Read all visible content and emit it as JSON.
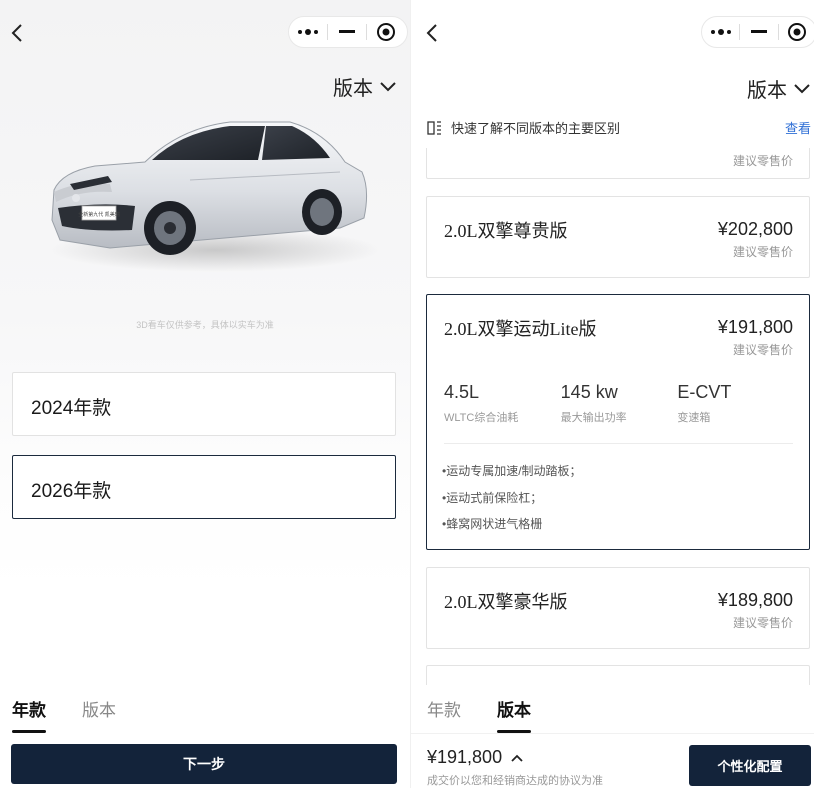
{
  "left": {
    "version_label": "版本",
    "car_disclaimer": "3D看车仅供参考，具体以实车为准",
    "car_plate_text": "全新第九代 凯美瑞",
    "years": [
      {
        "label": "2024年款",
        "selected": false
      },
      {
        "label": "2026年款",
        "selected": true
      }
    ],
    "tabs": [
      {
        "label": "年款",
        "active": true
      },
      {
        "label": "版本",
        "active": false
      }
    ],
    "next_button": "下一步"
  },
  "right": {
    "version_label": "版本",
    "hint_text": "快速了解不同版本的主要区别",
    "hint_link": "查看",
    "partial_top_sub": "建议零售价",
    "versions": [
      {
        "name": "2.0L双擎尊贵版",
        "price": "¥202,800",
        "price_note": "建议零售价",
        "selected": false
      },
      {
        "name": "2.0L双擎运动Lite版",
        "price": "¥191,800",
        "price_note": "建议零售价",
        "selected": true,
        "specs": [
          {
            "value": "4.5L",
            "label": "WLTC综合油耗"
          },
          {
            "value": "145 kw",
            "label": "最大输出功率"
          },
          {
            "value": "E-CVT",
            "label": "变速箱"
          }
        ],
        "features": [
          "•运动专属加速/制动踏板；",
          "•运动式前保险杠；",
          "•蜂窝网状进气格栅"
        ]
      },
      {
        "name": "2.0L双擎豪华版",
        "price": "¥189,800",
        "price_note": "建议零售价",
        "selected": false
      }
    ],
    "tabs": [
      {
        "label": "年款",
        "active": false
      },
      {
        "label": "版本",
        "active": true
      }
    ],
    "total_price": "¥191,800",
    "total_note": "成交价以您和经销商达成的协议为准",
    "custom_button": "个性化配置"
  },
  "colors": {
    "primary_dark": "#13233a",
    "link_blue": "#2f6fd6"
  },
  "icons": [
    "back-icon",
    "more-icon",
    "minimize-icon",
    "close-target-icon",
    "chevron-down-icon",
    "compare-icon",
    "chevron-up-icon"
  ]
}
